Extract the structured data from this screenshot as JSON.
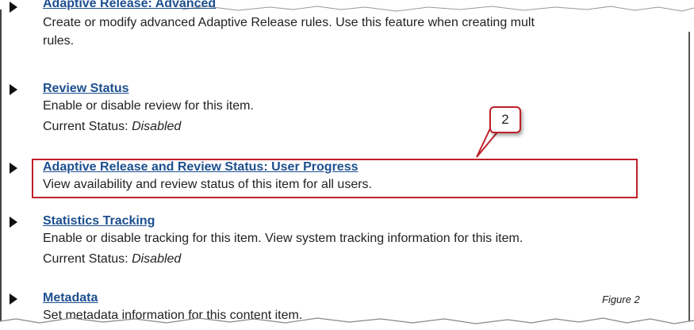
{
  "items": [
    {
      "title": "Adaptive Release: Advanced",
      "description": "Create or modify advanced Adaptive Release rules. Use this feature when creating mult",
      "description_cont": "rules."
    },
    {
      "title": "Review Status",
      "description": "Enable or disable review for this item.",
      "status_label": "Current Status:",
      "status_value": "Disabled"
    },
    {
      "title": "Adaptive Release and Review Status: User Progress",
      "description": "View availability and review status of this item for all users."
    },
    {
      "title": "Statistics Tracking",
      "description": "Enable or disable tracking for this item. View system tracking information for this item.",
      "status_label": "Current Status:",
      "status_value": "Disabled"
    },
    {
      "title": "Metadata",
      "description": "Set metadata information for this content item."
    }
  ],
  "callout": {
    "number": "2"
  },
  "figure_label": "Figure 2",
  "colors": {
    "link": "#1d4f8f",
    "highlight": "#c0202a"
  },
  "icons": {
    "bullet": "triangle-right-icon"
  }
}
